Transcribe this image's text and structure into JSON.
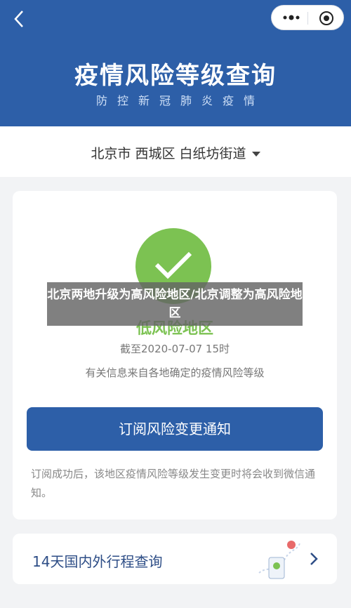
{
  "header": {
    "title": "疫情风险等级查询",
    "subtitle": "防控新冠肺炎疫情",
    "back_icon": "chevron-left-icon",
    "menu_icon": "more-dots-icon",
    "close_icon": "target-icon"
  },
  "location": {
    "text": "北京市 西城区 白纸坊街道"
  },
  "risk": {
    "level": "低风险地区",
    "as_of": "截至2020-07-07 15时",
    "basis": "有关信息来自各地确定的疫情风险等级",
    "subscribe_label": "订阅风险变更通知",
    "note": "订阅成功后，该地区疫情风险等级发生变更时将会收到微信通知。"
  },
  "trip": {
    "label": "14天国内外行程查询"
  },
  "overlay": {
    "caption": "北京两地升级为高风险地区/北京调整为高风险地区"
  },
  "colors": {
    "header": "#2d5fa8",
    "check": "#7cc252",
    "button": "#2d5fa8"
  }
}
